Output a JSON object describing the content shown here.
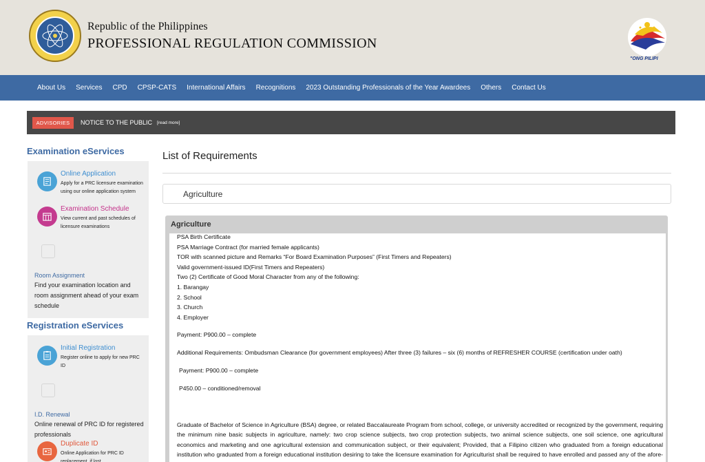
{
  "header": {
    "republic": "Republic of the Philippines",
    "commission": "PROFESSIONAL REGULATION COMMISSION",
    "bagong_caption": "\"ONG PILIPI"
  },
  "nav": {
    "items": [
      "About Us",
      "Services",
      "CPD",
      "CPSP-CATS",
      "International Affairs",
      "Recognitions",
      "2023 Outstanding Professionals of the Year Awardees",
      "Others",
      "Contact Us"
    ]
  },
  "advisory": {
    "badge": "ADVISORIES",
    "text": "NOTICE TO THE PUBLIC",
    "more": "[read more]"
  },
  "sidebar": {
    "exam_heading": "Examination eServices",
    "exam_services": [
      {
        "title": "Online Application",
        "desc": "Apply for a PRC licensure examination using our online application system",
        "color": "#4aa3d6",
        "title_color": "#3e8ed0"
      },
      {
        "title": "Examination Schedule",
        "desc": "View current and past schedules of licensure examinations",
        "color": "#c43b8f",
        "title_color": "#c4318a"
      }
    ],
    "room_title": "Room Assignment",
    "room_desc": "Find your examination location and room assignment ahead of your exam schedule",
    "reg_heading": "Registration eServices",
    "reg_services": [
      {
        "title": "Initial Registration",
        "desc": "Register online to apply for new PRC ID",
        "color": "#4aa3d6",
        "title_color": "#3e8ed0"
      }
    ],
    "id_title": "I.D. Renewal",
    "id_desc": "Online renewal of PRC ID for registered professionals",
    "dup": {
      "title": "Duplicate ID",
      "desc": "Online Application for PRC ID replacement, if lost",
      "color": "#e8663f",
      "title_color": "#e0573a"
    }
  },
  "main": {
    "title": "List of Requirements",
    "accordion_label": "Agriculture",
    "panel_heading": "Agriculture",
    "requirements": [
      "PSA Birth Certificate",
      "PSA Marriage Contract (for married female applicants)",
      "TOR with scanned picture and Remarks “For Board Examination Purposes” (First Timers and Repeaters)",
      "Valid government-issued ID(First Timers and Repeaters)",
      "Two (2) Certificate of Good Moral Character from any of the following:",
      "1. Barangay",
      "2. School",
      "3. Church",
      "4. Employer"
    ],
    "payment_1": "Payment: P900.00 – complete",
    "additional": "Additional Requirements: Ombudsman Clearance (for government employees) After three (3) failures – six (6) months of REFRESHER COURSE (certification under oath)",
    "payment_2": "Payment:  P900.00 – complete",
    "payment_3": "P450.00 – conditioned/removal",
    "paragraph": "Graduate of Bachelor of Science in Agriculture (BSA) degree, or related Baccalaureate Program from school, college, or university accredited or recognized by the government, requiring the minimum nine basic subjects in agriculture, namely: two crop science subjects, two crop protection subjects, two animal science subjects, one soil science, one agricultural economics and marketing and one agricultural extension and communication subject, or their equivalent; Provided, that a Filipino citizen who graduated from a foreign educational institution who graduated from a foreign educational institution desiring to take the licensure examination for Agriculturist shall be required to have enrolled and passed any of the afore-mentioned courses or their equivalent duly certified by the Commission on Higher Education (CHED)."
  }
}
